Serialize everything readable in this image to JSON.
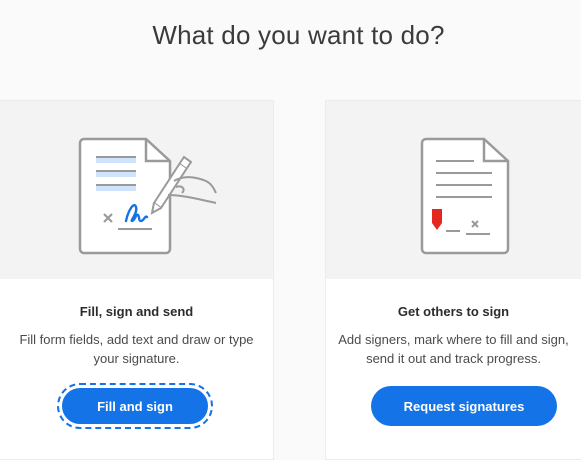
{
  "page": {
    "heading": "What do you want to do?"
  },
  "cards": [
    {
      "title": "Fill, sign and send",
      "description": "Fill form fields, add text and draw or type your signature.",
      "button_label": "Fill and sign",
      "illustration_icon": "document-signing-icon"
    },
    {
      "title": "Get others to sign",
      "description": "Add signers, mark where to fill and sign, send it out and track progress.",
      "button_label": "Request signatures",
      "illustration_icon": "document-request-signature-icon"
    }
  ],
  "colors": {
    "accent": "#1473e6",
    "marker_red": "#e4271f",
    "highlight_blue": "#cfe3fb"
  }
}
